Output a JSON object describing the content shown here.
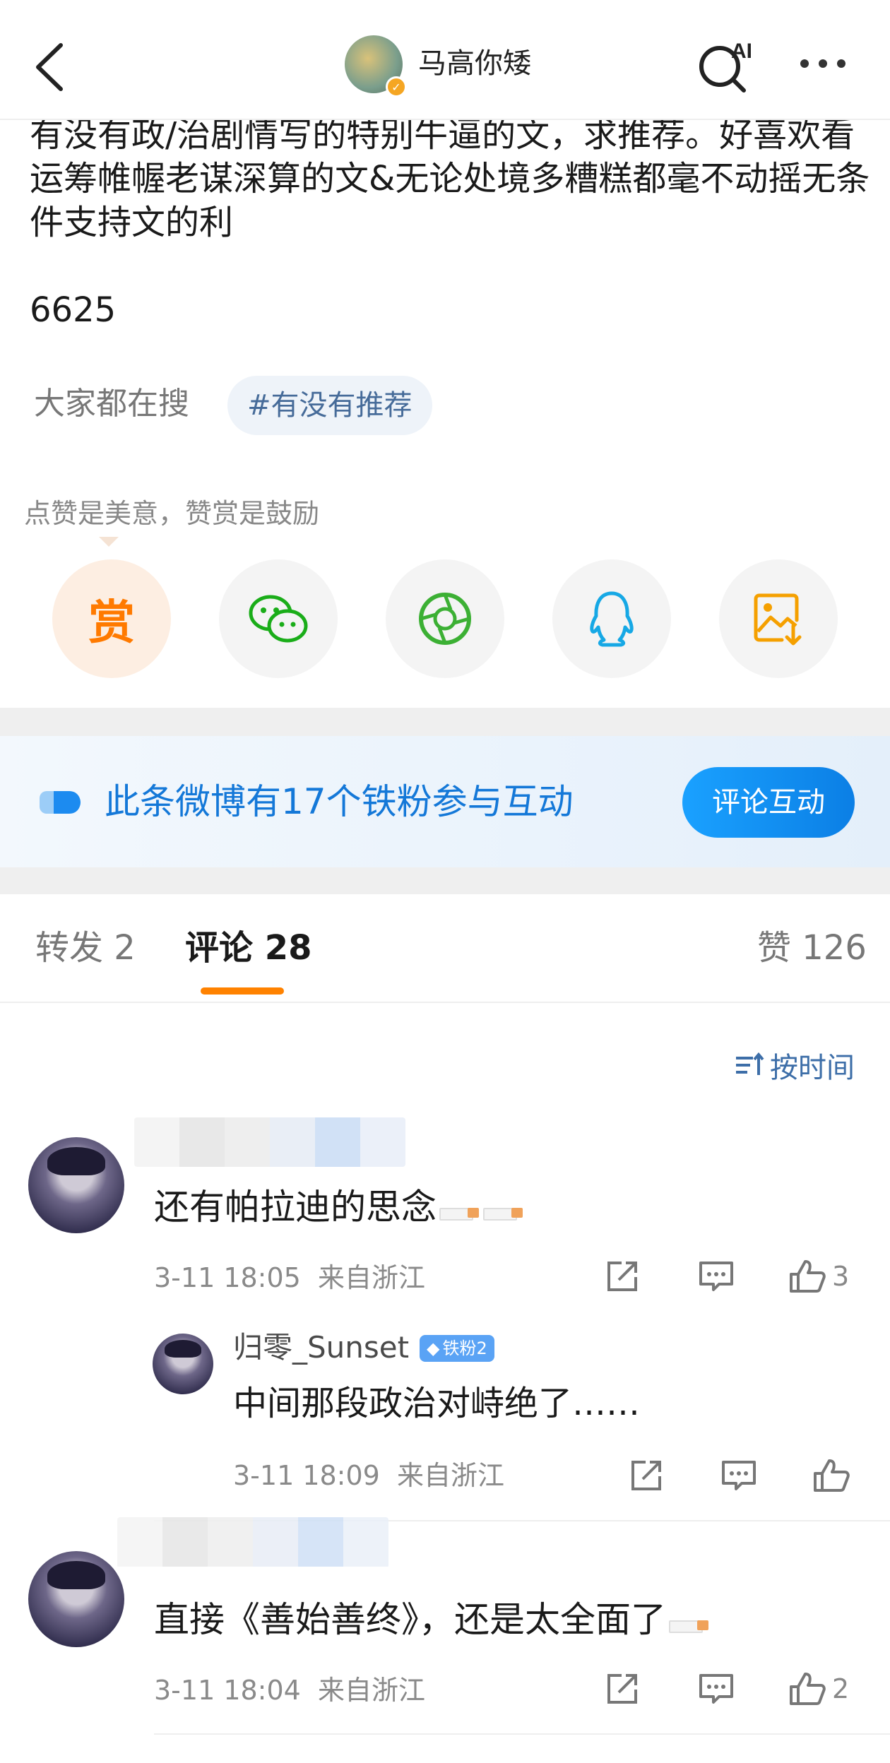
{
  "header": {
    "username": "马高你矮",
    "ai_label": "AI"
  },
  "post": {
    "text": "有没有政/治剧情写的特别牛逼的文，求推荐。好喜欢看运筹帷幄老谋深算的文&无论处境多糟糕都毫不动摇无条件支持文的利",
    "number": "6625",
    "search_label": "大家都在搜",
    "hashtag": "#有没有推荐"
  },
  "reward": {
    "hint": "点赞是美意，赞赏是鼓励",
    "reward_char": "赏",
    "share_icons": [
      "reward-icon",
      "wechat-icon",
      "moments-icon",
      "qq-icon",
      "save-image-icon"
    ]
  },
  "fan_banner": {
    "text": "此条微博有17个铁粉参与互动",
    "button": "评论互动"
  },
  "tabs": {
    "repost": "转发 2",
    "comment": "评论 28",
    "like": "赞 126"
  },
  "sort": {
    "label": "按时间"
  },
  "comments": [
    {
      "text": "还有帕拉迪的思念",
      "time": "3-11 18:05",
      "location": "来自浙江",
      "likes": "3",
      "reply": {
        "name": "归零_Sunset",
        "badge": "铁粉2",
        "text": "中间那段政治对峙绝了……",
        "time": "3-11 18:09",
        "location": "来自浙江"
      }
    },
    {
      "text": "直接《善始善终》，还是太全面了",
      "time": "3-11 18:04",
      "location": "来自浙江",
      "likes": "2"
    }
  ],
  "colors": {
    "accent": "#ff8200",
    "link_blue": "#1478d8",
    "hashtag_text": "#466b99"
  }
}
